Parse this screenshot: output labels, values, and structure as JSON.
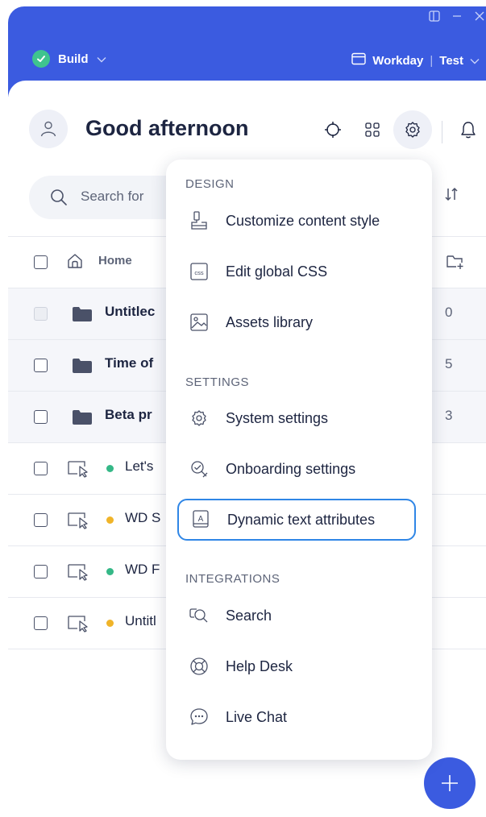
{
  "app": {
    "mode": "Build",
    "system": "Workday",
    "environment": "Test"
  },
  "header": {
    "greeting": "Good afternoon"
  },
  "search": {
    "placeholder": "Search for"
  },
  "list": {
    "home_label": "Home",
    "rows": [
      {
        "label": "Untitlec",
        "count": "0",
        "type": "folder"
      },
      {
        "label": "Time of",
        "count": "5",
        "type": "folder"
      },
      {
        "label": "Beta pr",
        "count": "3",
        "type": "folder"
      },
      {
        "label": "Let's",
        "type": "item",
        "status": "green"
      },
      {
        "label": "WD S",
        "type": "item",
        "status": "yellow"
      },
      {
        "label": "WD F",
        "type": "item",
        "status": "green"
      },
      {
        "label": "Untitl",
        "type": "item",
        "status": "yellow"
      }
    ]
  },
  "menu": {
    "design_heading": "DESIGN",
    "customize": "Customize content style",
    "edit_css": "Edit global CSS",
    "css_badge": "css",
    "assets": "Assets library",
    "settings_heading": "SETTINGS",
    "system_settings": "System settings",
    "onboarding": "Onboarding settings",
    "dynamic_text": "Dynamic text attributes",
    "dynamic_badge": "A",
    "integrations_heading": "INTEGRATIONS",
    "search": "Search",
    "help_desk": "Help Desk",
    "live_chat": "Live Chat"
  },
  "colors": {
    "brand": "#3b5be0",
    "status_green": "#35b887",
    "status_yellow": "#f0b429",
    "selected_outline": "#2f86e6"
  }
}
